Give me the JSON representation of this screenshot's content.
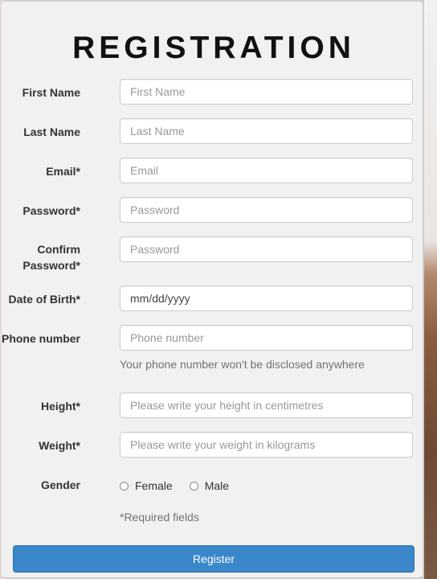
{
  "form": {
    "title": "REGISTRATION",
    "fields": {
      "first_name": {
        "label": "First Name",
        "placeholder": "First Name"
      },
      "last_name": {
        "label": "Last Name",
        "placeholder": "Last Name"
      },
      "email": {
        "label": "Email*",
        "placeholder": "Email"
      },
      "password": {
        "label": "Password*",
        "placeholder": "Password"
      },
      "confirm_password": {
        "label_line1": "Confirm",
        "label_line2": "Password*",
        "placeholder": "Password"
      },
      "dob": {
        "label": "Date of Birth*",
        "placeholder": "mm/dd/yyyy"
      },
      "phone": {
        "label": "Phone number",
        "placeholder": "Phone number",
        "help": "Your phone number won't be disclosed anywhere"
      },
      "height": {
        "label": "Height*",
        "placeholder": "Please write your height in centimetres"
      },
      "weight": {
        "label": "Weight*",
        "placeholder": "Please write your weight in kilograms"
      }
    },
    "gender": {
      "label": "Gender",
      "options": [
        "Female",
        "Male"
      ]
    },
    "required_note": "*Required fields",
    "submit_label": "Register"
  },
  "colors": {
    "button": "#3a87c9",
    "card": "#f1f1f1"
  }
}
